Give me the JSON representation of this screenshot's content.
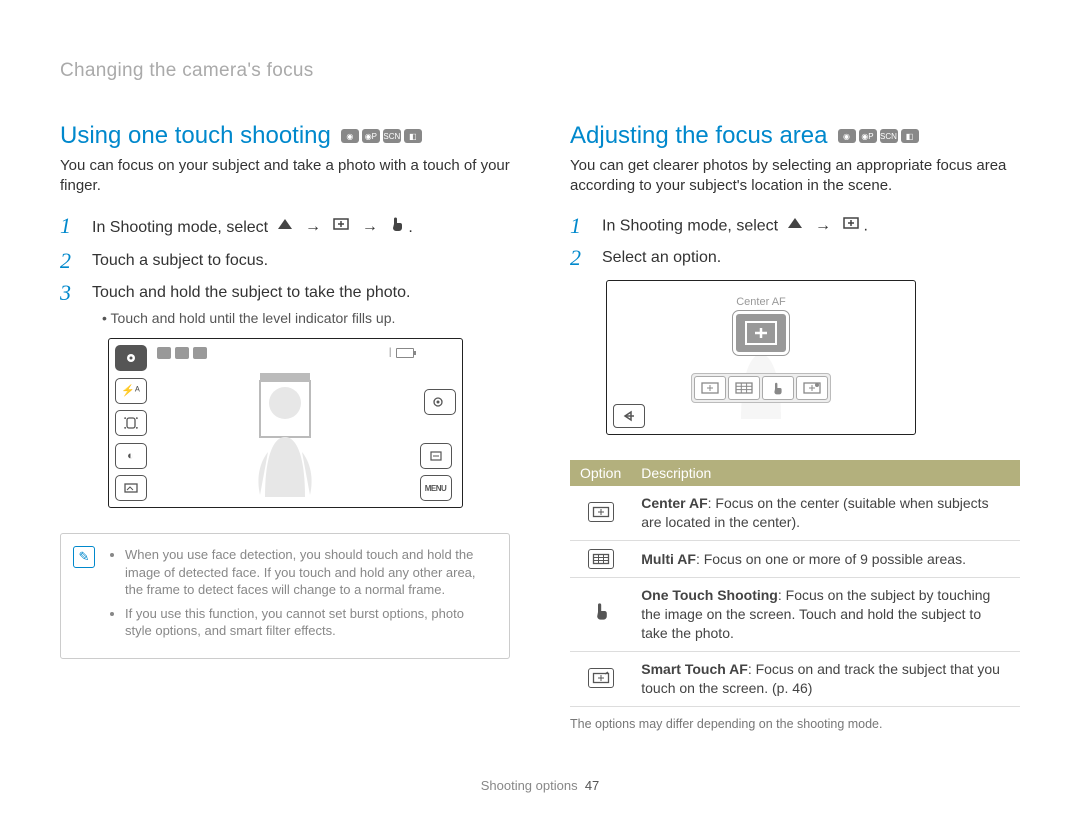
{
  "breadcrumb": "Changing the camera's focus",
  "left": {
    "title": "Using one touch shooting",
    "intro": "You can focus on your subject and take a photo with a touch of your finger.",
    "step1_pre": "In Shooting mode, select ",
    "step2": "Touch a subject to focus.",
    "step3": "Touch and hold the subject to take the photo.",
    "step3_sub": "Touch and hold until the level indicator fills up.",
    "note1": "When you use face detection, you should touch and hold the image of detected face. If you touch and hold any other area, the frame to detect faces will change to a normal frame.",
    "note2": "If you use this function, you cannot set burst options, photo style options, and smart filter effects.",
    "menu_label": "MENU"
  },
  "right": {
    "title": "Adjusting the focus area",
    "intro": "You can get clearer photos by selecting an appropriate focus area according to your subject's location in the scene.",
    "step1_pre": "In Shooting mode, select ",
    "step2": "Select an option.",
    "selected_label": "Center AF",
    "table": {
      "h1": "Option",
      "h2": "Description",
      "r1_b": "Center AF",
      "r1": ": Focus on the center (suitable when subjects are located in the center).",
      "r2_b": "Multi AF",
      "r2": ": Focus on one or more of 9 possible areas.",
      "r3_b": "One Touch Shooting",
      "r3": ": Focus on the subject by touching the image on the screen. Touch and hold the subject to take the photo.",
      "r4_b": "Smart Touch AF",
      "r4": ": Focus on and track the subject that you touch on the screen. (p. 46)"
    },
    "footnote": "The options may differ depending on the shooting mode."
  },
  "footer": {
    "section": "Shooting options",
    "page": "47"
  },
  "glyphs": {
    "arrow": "→"
  }
}
